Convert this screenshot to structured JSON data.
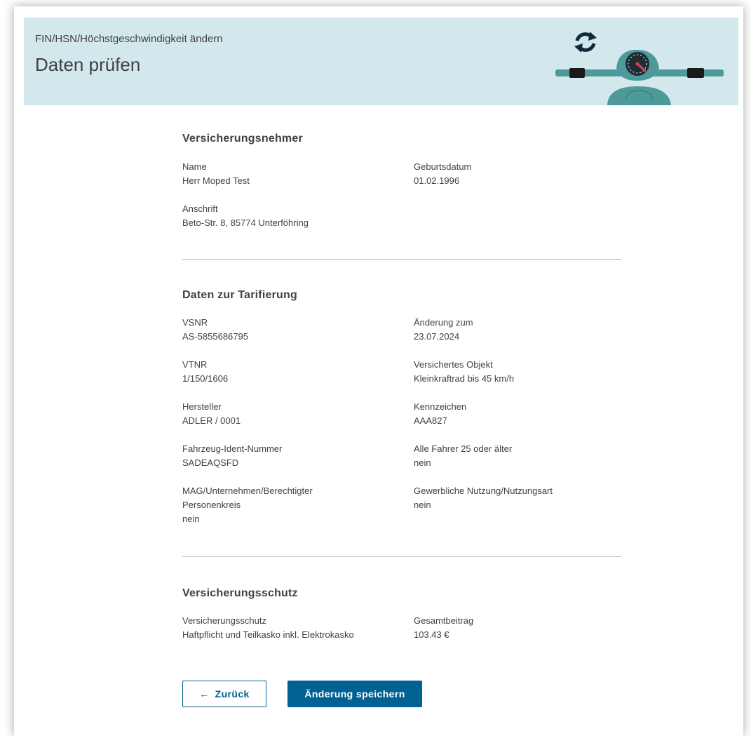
{
  "header": {
    "subtitle": "FIN/HSN/Höchstgeschwindigkeit ändern",
    "title": "Daten prüfen",
    "illustration_icon": "scooter-handlebar-icon",
    "refresh_icon": "refresh-arrows-icon"
  },
  "policyholder": {
    "title": "Versicherungsnehmer",
    "name_label": "Name",
    "name_value": "Herr Moped Test",
    "birthdate_label": "Geburtsdatum",
    "birthdate_value": "01.02.1996",
    "address_label": "Anschrift",
    "address_value": "Beto-Str. 8, 85774 Unterföhring"
  },
  "tariff": {
    "title": "Daten zur Tarifierung",
    "vsnr_label": "VSNR",
    "vsnr_value": "AS-5855686795",
    "change_date_label": "Änderung zum",
    "change_date_value": "23.07.2024",
    "vtnr_label": "VTNR",
    "vtnr_value": "1/150/1606",
    "object_label": "Versichertes Objekt",
    "object_value": "Kleinkraftrad bis 45 km/h",
    "manufacturer_label": "Hersteller",
    "manufacturer_value": "ADLER / 0001",
    "plate_label": "Kennzeichen",
    "plate_value": "AAA827",
    "vin_label": "Fahrzeug-Ident-Nummer",
    "vin_value": "SADEAQSFD",
    "drivers_label": "Alle Fahrer 25 oder älter",
    "drivers_value": "nein",
    "mag_label_line1": "MAG/Unternehmen/Berechtigter",
    "mag_label_line2": "Personenkreis",
    "mag_value": "nein",
    "commercial_label": "Gewerbliche Nutzung/Nutzungsart",
    "commercial_value": "nein"
  },
  "coverage": {
    "title": "Versicherungsschutz",
    "coverage_label": "Versicherungsschutz",
    "coverage_value": "Haftpflicht und Teilkasko inkl. Elektrokasko",
    "total_label": "Gesamtbeitrag",
    "total_value": "103.43 €"
  },
  "actions": {
    "back_arrow": "←",
    "back_label": "Zurück",
    "save_label": "Änderung speichern"
  },
  "colors": {
    "header_bg": "#d2e8ed",
    "primary": "#006192",
    "illustration_teal": "#4e9a9a",
    "text": "#414141"
  }
}
